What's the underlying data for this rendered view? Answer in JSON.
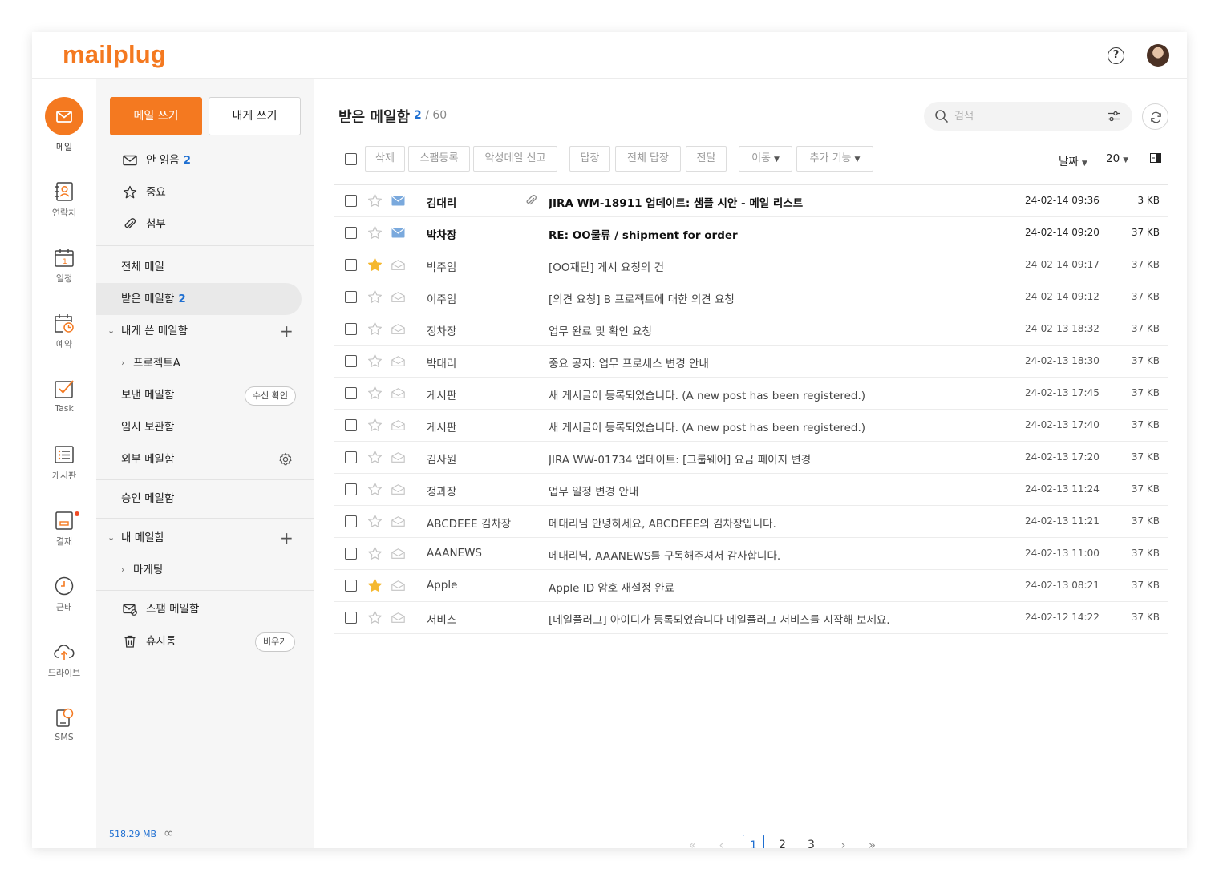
{
  "app": {
    "logo": "mailplug"
  },
  "header": {
    "help_icon": "question-circle-icon",
    "avatar": "user-avatar"
  },
  "rail": [
    {
      "label": "메일",
      "icon": "mail-icon",
      "active": true
    },
    {
      "label": "연락처",
      "icon": "contacts-icon"
    },
    {
      "label": "일정",
      "icon": "calendar-icon"
    },
    {
      "label": "예약",
      "icon": "reservation-icon"
    },
    {
      "label": "Task",
      "icon": "task-icon"
    },
    {
      "label": "게시판",
      "icon": "board-icon"
    },
    {
      "label": "결재",
      "icon": "approval-icon",
      "notification": true
    },
    {
      "label": "근태",
      "icon": "clock-icon"
    },
    {
      "label": "드라이브",
      "icon": "cloud-icon"
    },
    {
      "label": "SMS",
      "icon": "sms-icon"
    }
  ],
  "sidebar": {
    "compose": "메일 쓰기",
    "compose_self": "내게 쓰기",
    "quick": [
      {
        "label": "안 읽음",
        "count": "2",
        "icon": "envelope-icon"
      },
      {
        "label": "중요",
        "count": "",
        "icon": "star-icon"
      },
      {
        "label": "첨부",
        "count": "",
        "icon": "paperclip-icon"
      }
    ],
    "all_mail": "전체 메일",
    "inbox": {
      "label": "받은 메일함",
      "count": "2"
    },
    "self_box": "내게 쓴 메일함",
    "project_a": "프로젝트A",
    "sent": {
      "label": "보낸 메일함",
      "pill": "수신 확인"
    },
    "drafts": "임시 보관함",
    "external": "외부 메일함",
    "approval": "승인 메일함",
    "my_box": "내 메일함",
    "marketing": "마케팅",
    "spam": "스팸 메일함",
    "trash": {
      "label": "휴지통",
      "pill": "비우기"
    },
    "storage": "518.29 MB",
    "quota": "∞"
  },
  "main": {
    "title": "받은 메일함",
    "unread": "2",
    "total": "/ 60",
    "search_placeholder": "검색",
    "toolbar": [
      "삭제",
      "스팸등록",
      "악성메일 신고",
      "답장",
      "전체 답장",
      "전달"
    ],
    "move": "이동",
    "more": "추가 기능",
    "sort": "날짜",
    "page_size": "20"
  },
  "emails": [
    {
      "sender": "김대리",
      "subject": "JIRA WM-18911 업데이트: 샘플 시안 - 메일 리스트",
      "date": "24-02-14 09:36",
      "size": "3 KB",
      "unread": true,
      "starred": false,
      "attachment": true
    },
    {
      "sender": "박차장",
      "subject": "RE: OO물류 / shipment for order",
      "date": "24-02-14 09:20",
      "size": "37 KB",
      "unread": true,
      "starred": false,
      "attachment": false
    },
    {
      "sender": "박주임",
      "subject": "[OO재단] 게시 요청의 건",
      "date": "24-02-14 09:17",
      "size": "37 KB",
      "unread": false,
      "starred": true,
      "attachment": false
    },
    {
      "sender": "이주임",
      "subject": "[의견 요청] B 프로젝트에 대한 의견 요청",
      "date": "24-02-14 09:12",
      "size": "37 KB",
      "unread": false,
      "starred": false,
      "attachment": false
    },
    {
      "sender": "정차장",
      "subject": "업무 완료 및 확인 요청",
      "date": "24-02-13 18:32",
      "size": "37 KB",
      "unread": false,
      "starred": false,
      "attachment": false
    },
    {
      "sender": "박대리",
      "subject": "중요 공지: 업무 프로세스 변경 안내",
      "date": "24-02-13 18:30",
      "size": "37 KB",
      "unread": false,
      "starred": false,
      "attachment": false
    },
    {
      "sender": "게시판",
      "subject": "새 게시글이 등록되었습니다. (A new post has been registered.)",
      "date": "24-02-13 17:45",
      "size": "37 KB",
      "unread": false,
      "starred": false,
      "attachment": false
    },
    {
      "sender": "게시판",
      "subject": "새 게시글이 등록되었습니다. (A new post has been registered.)",
      "date": "24-02-13 17:40",
      "size": "37 KB",
      "unread": false,
      "starred": false,
      "attachment": false
    },
    {
      "sender": "김사원",
      "subject": "JIRA WW-01734 업데이트: [그룹웨어] 요금 페이지 변경",
      "date": "24-02-13 17:20",
      "size": "37 KB",
      "unread": false,
      "starred": false,
      "attachment": false
    },
    {
      "sender": "정과장",
      "subject": "업무 일정 변경 안내",
      "date": "24-02-13 11:24",
      "size": "37 KB",
      "unread": false,
      "starred": false,
      "attachment": false
    },
    {
      "sender": "ABCDEEE 김차장",
      "subject": "메대리님 안녕하세요, ABCDEEE의 김차장입니다.",
      "date": "24-02-13 11:21",
      "size": "37 KB",
      "unread": false,
      "starred": false,
      "attachment": false
    },
    {
      "sender": "AAANEWS",
      "subject": "메대리님, AAANEWS를 구독해주셔서 감사합니다.",
      "date": "24-02-13 11:00",
      "size": "37 KB",
      "unread": false,
      "starred": false,
      "attachment": false
    },
    {
      "sender": "Apple",
      "subject": "Apple ID 암호 재설정 완료",
      "date": "24-02-13 08:21",
      "size": "37 KB",
      "unread": false,
      "starred": true,
      "attachment": false
    },
    {
      "sender": "서비스",
      "subject": "[메일플러그] 아이디가 등록되었습니다 메일플러그 서비스를 시작해 보세요.",
      "date": "24-02-12 14:22",
      "size": "37 KB",
      "unread": false,
      "starred": false,
      "attachment": false
    }
  ],
  "pagination": {
    "pages": [
      "1",
      "2",
      "3"
    ],
    "current": "1",
    "first": "«",
    "prev": "‹",
    "next": "›",
    "last": "»"
  },
  "colors": {
    "brand": "#f47920",
    "accent": "#1f6fd1",
    "star": "#f5b82e"
  }
}
